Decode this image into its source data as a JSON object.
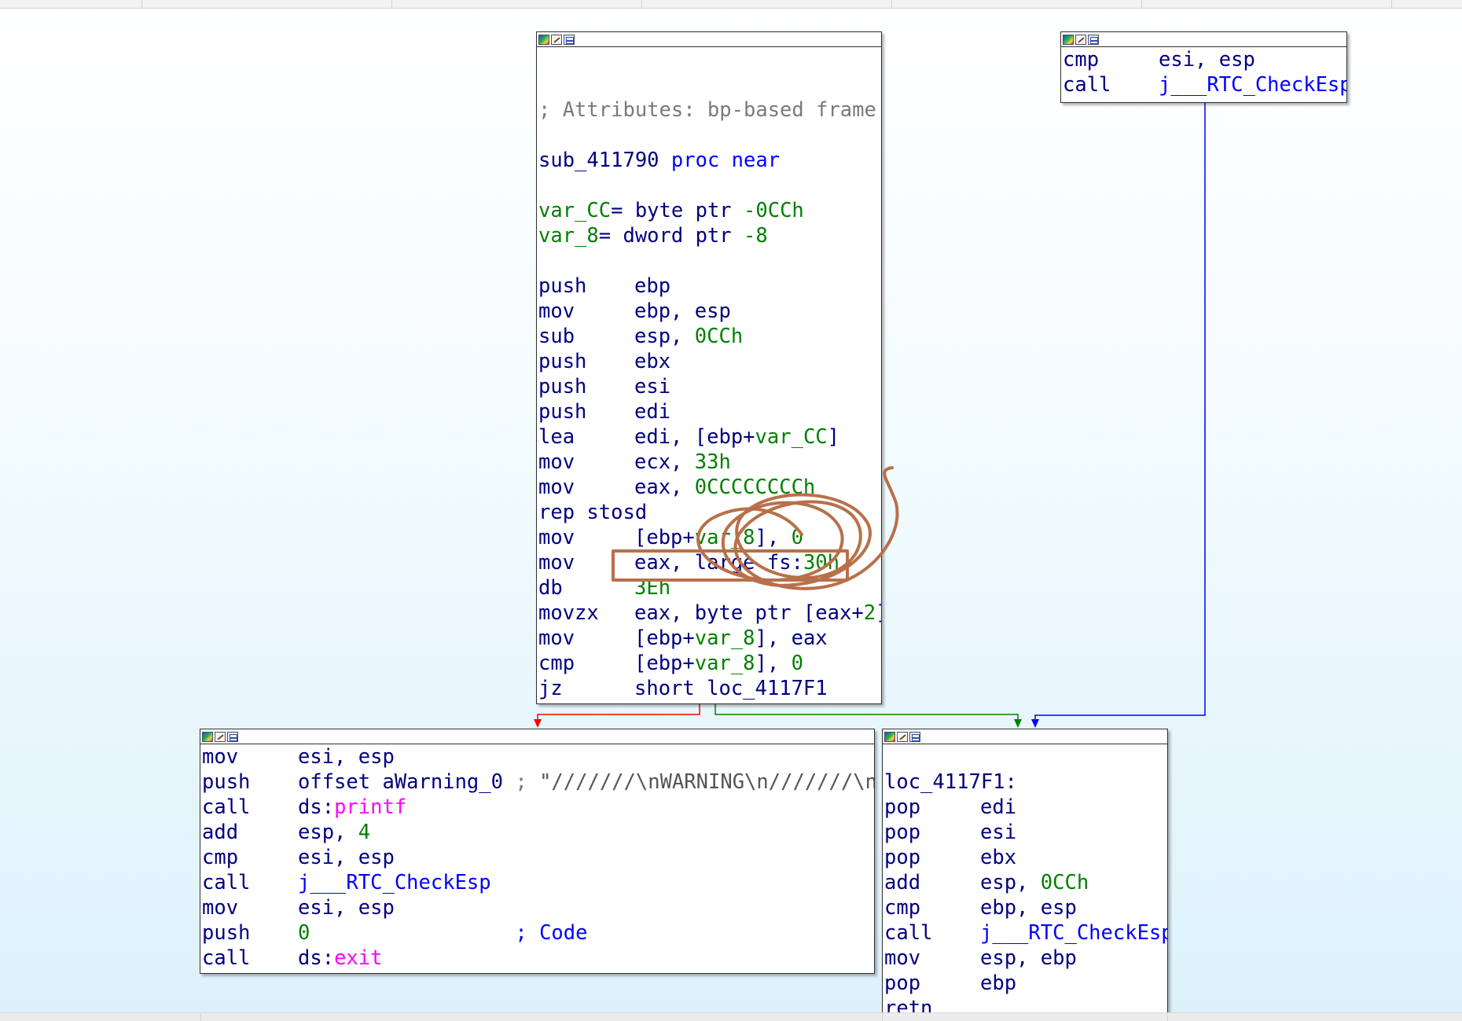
{
  "colors": {
    "edge_false": "#ff0000",
    "edge_true": "#008000",
    "edge_uncond": "#0000ff",
    "annotation": "#b8704a"
  },
  "icons": [
    "color-palette-icon",
    "edit-icon",
    "graph-icon"
  ],
  "main_block": {
    "attributes": "; Attributes: bp-based frame",
    "proc_name": "sub_411790",
    "proc_kw": "proc near",
    "vars": [
      {
        "name": "var_CC",
        "rest": "= byte ptr ",
        "val": "-0CCh"
      },
      {
        "name": "var_8",
        "rest": "= dword ptr ",
        "val": "-8"
      }
    ],
    "lines": [
      [
        [
          "push",
          "m"
        ],
        [
          "ebp",
          "o"
        ]
      ],
      [
        [
          "mov",
          "m"
        ],
        [
          "ebp, esp",
          "o"
        ]
      ],
      [
        [
          "sub",
          "m"
        ],
        [
          "esp, ",
          "o"
        ],
        [
          "0CCh",
          "n"
        ]
      ],
      [
        [
          "push",
          "m"
        ],
        [
          "ebx",
          "o"
        ]
      ],
      [
        [
          "push",
          "m"
        ],
        [
          "esi",
          "o"
        ]
      ],
      [
        [
          "push",
          "m"
        ],
        [
          "edi",
          "o"
        ]
      ],
      [
        [
          "lea",
          "m"
        ],
        [
          "edi, [ebp+",
          "o"
        ],
        [
          "var_CC",
          "n"
        ],
        [
          "]",
          "o"
        ]
      ],
      [
        [
          "mov",
          "m"
        ],
        [
          "ecx, ",
          "o"
        ],
        [
          "33h",
          "n"
        ]
      ],
      [
        [
          "mov",
          "m"
        ],
        [
          "eax, ",
          "o"
        ],
        [
          "0CCCCCCCCh",
          "n"
        ]
      ],
      [
        [
          "rep stosd",
          "o"
        ]
      ],
      [
        [
          "mov",
          "m"
        ],
        [
          "[ebp+",
          "o"
        ],
        [
          "var_8",
          "n"
        ],
        [
          "], ",
          "o"
        ],
        [
          "0",
          "n"
        ]
      ],
      [
        [
          "mov",
          "m"
        ],
        [
          "eax, large fs:",
          "o"
        ],
        [
          "30h",
          "n"
        ]
      ],
      [
        [
          "db",
          "m"
        ],
        [
          "3Eh",
          "n"
        ]
      ],
      [
        [
          "movzx",
          "m"
        ],
        [
          "eax, byte ptr [eax+",
          "o"
        ],
        [
          "2",
          "n"
        ],
        [
          "]",
          "o"
        ]
      ],
      [
        [
          "mov",
          "m"
        ],
        [
          "[ebp+",
          "o"
        ],
        [
          "var_8",
          "n"
        ],
        [
          "], eax",
          "o"
        ]
      ],
      [
        [
          "cmp",
          "m"
        ],
        [
          "[ebp+",
          "o"
        ],
        [
          "var_8",
          "n"
        ],
        [
          "], ",
          "o"
        ],
        [
          "0",
          "n"
        ]
      ],
      [
        [
          "jz",
          "m"
        ],
        [
          "short loc_4117F1",
          "o"
        ]
      ]
    ]
  },
  "top_right_block": {
    "lines": [
      [
        [
          "cmp",
          "m"
        ],
        [
          "esi, esp",
          "o"
        ]
      ],
      [
        [
          "call",
          "m"
        ],
        [
          "j___RTC_CheckEsp",
          "b"
        ]
      ]
    ]
  },
  "bottom_left_block": {
    "lines": [
      [
        [
          "mov",
          "m"
        ],
        [
          "esi, esp",
          "o"
        ]
      ],
      [
        [
          "push",
          "m"
        ],
        [
          "offset aWarning_0 ",
          "o"
        ],
        [
          "; ",
          "g"
        ],
        [
          "\"///////\\nWARNING\\n///////\\n\"",
          "s"
        ]
      ],
      [
        [
          "call",
          "m"
        ],
        [
          "ds:",
          "o"
        ],
        [
          "printf",
          "p"
        ]
      ],
      [
        [
          "add",
          "m"
        ],
        [
          "esp, ",
          "o"
        ],
        [
          "4",
          "n"
        ]
      ],
      [
        [
          "cmp",
          "m"
        ],
        [
          "esi, esp",
          "o"
        ]
      ],
      [
        [
          "call",
          "m"
        ],
        [
          "j___RTC_CheckEsp",
          "b"
        ]
      ],
      [
        [
          "mov",
          "m"
        ],
        [
          "esi, esp",
          "o"
        ]
      ],
      [
        [
          "push",
          "m"
        ],
        [
          "0",
          "n"
        ],
        [
          "                 ",
          "o"
        ],
        [
          "; Code",
          "b"
        ]
      ],
      [
        [
          "call",
          "m"
        ],
        [
          "ds:",
          "o"
        ],
        [
          "exit",
          "p"
        ]
      ]
    ]
  },
  "bottom_right_block": {
    "label": "loc_4117F1:",
    "lines": [
      [
        [
          "pop",
          "m"
        ],
        [
          "edi",
          "o"
        ]
      ],
      [
        [
          "pop",
          "m"
        ],
        [
          "esi",
          "o"
        ]
      ],
      [
        [
          "pop",
          "m"
        ],
        [
          "ebx",
          "o"
        ]
      ],
      [
        [
          "add",
          "m"
        ],
        [
          "esp, ",
          "o"
        ],
        [
          "0CCh",
          "n"
        ]
      ],
      [
        [
          "cmp",
          "m"
        ],
        [
          "ebp, esp",
          "o"
        ]
      ],
      [
        [
          "call",
          "m"
        ],
        [
          "j___RTC_CheckEsp",
          "b"
        ]
      ],
      [
        [
          "mov",
          "m"
        ],
        [
          "esp, ebp",
          "o"
        ]
      ],
      [
        [
          "pop",
          "m"
        ],
        [
          "ebp",
          "o"
        ]
      ],
      [
        [
          "retn",
          "m"
        ]
      ]
    ]
  }
}
